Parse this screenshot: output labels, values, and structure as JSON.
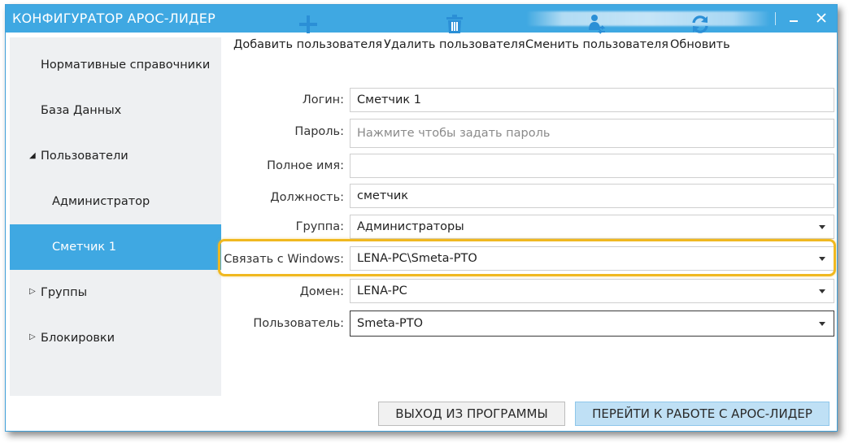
{
  "window": {
    "title": "КОНФИГУРАТОР АРОС-ЛИДЕР",
    "minimize_label": "_",
    "close_label": "×"
  },
  "sidebar": {
    "items": [
      {
        "label": "Нормативные справочники"
      },
      {
        "label": "База Данных"
      },
      {
        "label": "Пользователи",
        "expander": "◢"
      },
      {
        "label": "Администратор"
      },
      {
        "label": "Сметчик 1"
      },
      {
        "label": "Группы",
        "expander": "▷"
      },
      {
        "label": "Блокировки",
        "expander": "▷"
      }
    ]
  },
  "toolbar": {
    "add": {
      "label": "Добавить пользователя",
      "icon": "plus-icon"
    },
    "delete": {
      "label": "Удалить пользователя",
      "icon": "trash-icon"
    },
    "change": {
      "label": "Сменить пользователя",
      "icon": "user-switch-icon"
    },
    "refresh": {
      "label": "Обновить",
      "icon": "refresh-icon"
    }
  },
  "form": {
    "login": {
      "label": "Логин:",
      "value": "Сметчик 1"
    },
    "password": {
      "label": "Пароль:",
      "placeholder": "Нажмите чтобы задать пароль"
    },
    "fullname": {
      "label": "Полное имя:",
      "value": ""
    },
    "position": {
      "label": "Должность:",
      "value": "сметчик"
    },
    "group": {
      "label": "Группа:",
      "value": "Администраторы"
    },
    "windows_link": {
      "label": "Связать с Windows:",
      "value": "LENA-PC\\Smeta-PTO"
    },
    "domain": {
      "label": "Домен:",
      "value": "LENA-PC"
    },
    "user": {
      "label": "Пользователь:",
      "value": "Smeta-PTO"
    }
  },
  "footer": {
    "exit_label": "ВЫХОД ИЗ ПРОГРАММЫ",
    "go_label": "ПЕРЕЙТИ К РАБОТЕ С АРОС-ЛИДЕР"
  },
  "colors": {
    "accent": "#3fa8e2",
    "highlight": "#f0b820",
    "sidebar_bg": "#eef0f2"
  }
}
